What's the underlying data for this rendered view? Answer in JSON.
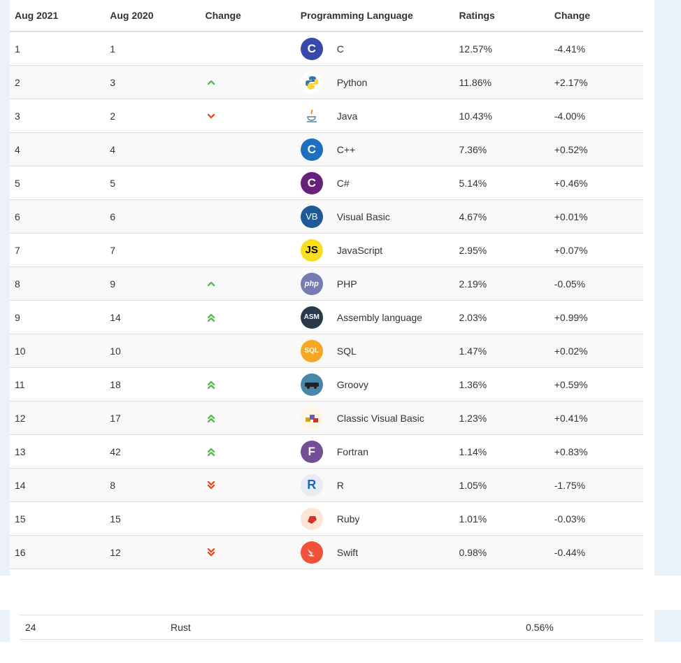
{
  "table": {
    "headers": [
      "Aug 2021",
      "Aug 2020",
      "Change",
      "Programming Language",
      "Ratings",
      "Change"
    ],
    "rows": [
      {
        "rank2021": "1",
        "rank2020": "1",
        "change": "none",
        "logo": "c-logo",
        "language": "C",
        "rating": "12.57%",
        "delta": "-4.41%"
      },
      {
        "rank2021": "2",
        "rank2020": "3",
        "change": "up",
        "logo": "python-logo",
        "language": "Python",
        "rating": "11.86%",
        "delta": "+2.17%"
      },
      {
        "rank2021": "3",
        "rank2020": "2",
        "change": "down",
        "logo": "java-logo",
        "language": "Java",
        "rating": "10.43%",
        "delta": "-4.00%"
      },
      {
        "rank2021": "4",
        "rank2020": "4",
        "change": "none",
        "logo": "cpp-logo",
        "language": "C++",
        "rating": "7.36%",
        "delta": "+0.52%"
      },
      {
        "rank2021": "5",
        "rank2020": "5",
        "change": "none",
        "logo": "csharp-logo",
        "language": "C#",
        "rating": "5.14%",
        "delta": "+0.46%"
      },
      {
        "rank2021": "6",
        "rank2020": "6",
        "change": "none",
        "logo": "vb-logo",
        "language": "Visual Basic",
        "rating": "4.67%",
        "delta": "+0.01%"
      },
      {
        "rank2021": "7",
        "rank2020": "7",
        "change": "none",
        "logo": "js-logo",
        "language": "JavaScript",
        "rating": "2.95%",
        "delta": "+0.07%"
      },
      {
        "rank2021": "8",
        "rank2020": "9",
        "change": "up",
        "logo": "php-logo",
        "language": "PHP",
        "rating": "2.19%",
        "delta": "-0.05%"
      },
      {
        "rank2021": "9",
        "rank2020": "14",
        "change": "up-double",
        "logo": "asm-logo",
        "language": "Assembly language",
        "rating": "2.03%",
        "delta": "+0.99%"
      },
      {
        "rank2021": "10",
        "rank2020": "10",
        "change": "none",
        "logo": "sql-logo",
        "language": "SQL",
        "rating": "1.47%",
        "delta": "+0.02%"
      },
      {
        "rank2021": "11",
        "rank2020": "18",
        "change": "up-double",
        "logo": "groovy-logo",
        "language": "Groovy",
        "rating": "1.36%",
        "delta": "+0.59%"
      },
      {
        "rank2021": "12",
        "rank2020": "17",
        "change": "up-double",
        "logo": "classic-vb-logo",
        "language": "Classic Visual Basic",
        "rating": "1.23%",
        "delta": "+0.41%"
      },
      {
        "rank2021": "13",
        "rank2020": "42",
        "change": "up-double",
        "logo": "fortran-logo",
        "language": "Fortran",
        "rating": "1.14%",
        "delta": "+0.83%"
      },
      {
        "rank2021": "14",
        "rank2020": "8",
        "change": "down-double",
        "logo": "r-logo",
        "language": "R",
        "rating": "1.05%",
        "delta": "-1.75%"
      },
      {
        "rank2021": "15",
        "rank2020": "15",
        "change": "none",
        "logo": "ruby-logo",
        "language": "Ruby",
        "rating": "1.01%",
        "delta": "-0.03%"
      },
      {
        "rank2021": "16",
        "rank2020": "12",
        "change": "down-double",
        "logo": "swift-logo",
        "language": "Swift",
        "rating": "0.98%",
        "delta": "-0.44%"
      }
    ]
  },
  "logos": {
    "c-logo": {
      "text": "C",
      "bg": "#3949ab",
      "fg": "#ffffff"
    },
    "python-logo": {
      "text": "",
      "bg": "#ffffff",
      "fg": "#3776ab"
    },
    "java-logo": {
      "text": "",
      "bg": "#ffffff",
      "fg": "#e76f00"
    },
    "cpp-logo": {
      "text": "C",
      "bg": "#1e6fc0",
      "fg": "#ffffff"
    },
    "csharp-logo": {
      "text": "C",
      "bg": "#68217a",
      "fg": "#ffffff"
    },
    "vb-logo": {
      "text": "VB",
      "bg": "#1f5a96",
      "fg": "#ffffff"
    },
    "js-logo": {
      "text": "JS",
      "bg": "#f7df1e",
      "fg": "#000000"
    },
    "php-logo": {
      "text": "php",
      "bg": "#777bb3",
      "fg": "#ffffff"
    },
    "asm-logo": {
      "text": "ASM",
      "bg": "#2b3a4a",
      "fg": "#ffffff"
    },
    "sql-logo": {
      "text": "SQL",
      "bg": "#f5a623",
      "fg": "#ffffff"
    },
    "groovy-logo": {
      "text": "",
      "bg": "#4a86a8",
      "fg": "#ffffff"
    },
    "classic-vb-logo": {
      "text": "",
      "bg": "#fdf5e6",
      "fg": "#6a5acd"
    },
    "fortran-logo": {
      "text": "F",
      "bg": "#734f96",
      "fg": "#ffffff"
    },
    "r-logo": {
      "text": "R",
      "bg": "#e8ecf2",
      "fg": "#2166b0"
    },
    "ruby-logo": {
      "text": "",
      "bg": "#fde5d5",
      "fg": "#cc342d"
    },
    "swift-logo": {
      "text": "",
      "bg": "#f05138",
      "fg": "#ffffff"
    }
  },
  "colors": {
    "up": "#5cb85c",
    "down": "#e8501f",
    "border": "#dddddd"
  },
  "extra_row": {
    "rank": "24",
    "language": "Rust",
    "rating": "0.56%"
  }
}
